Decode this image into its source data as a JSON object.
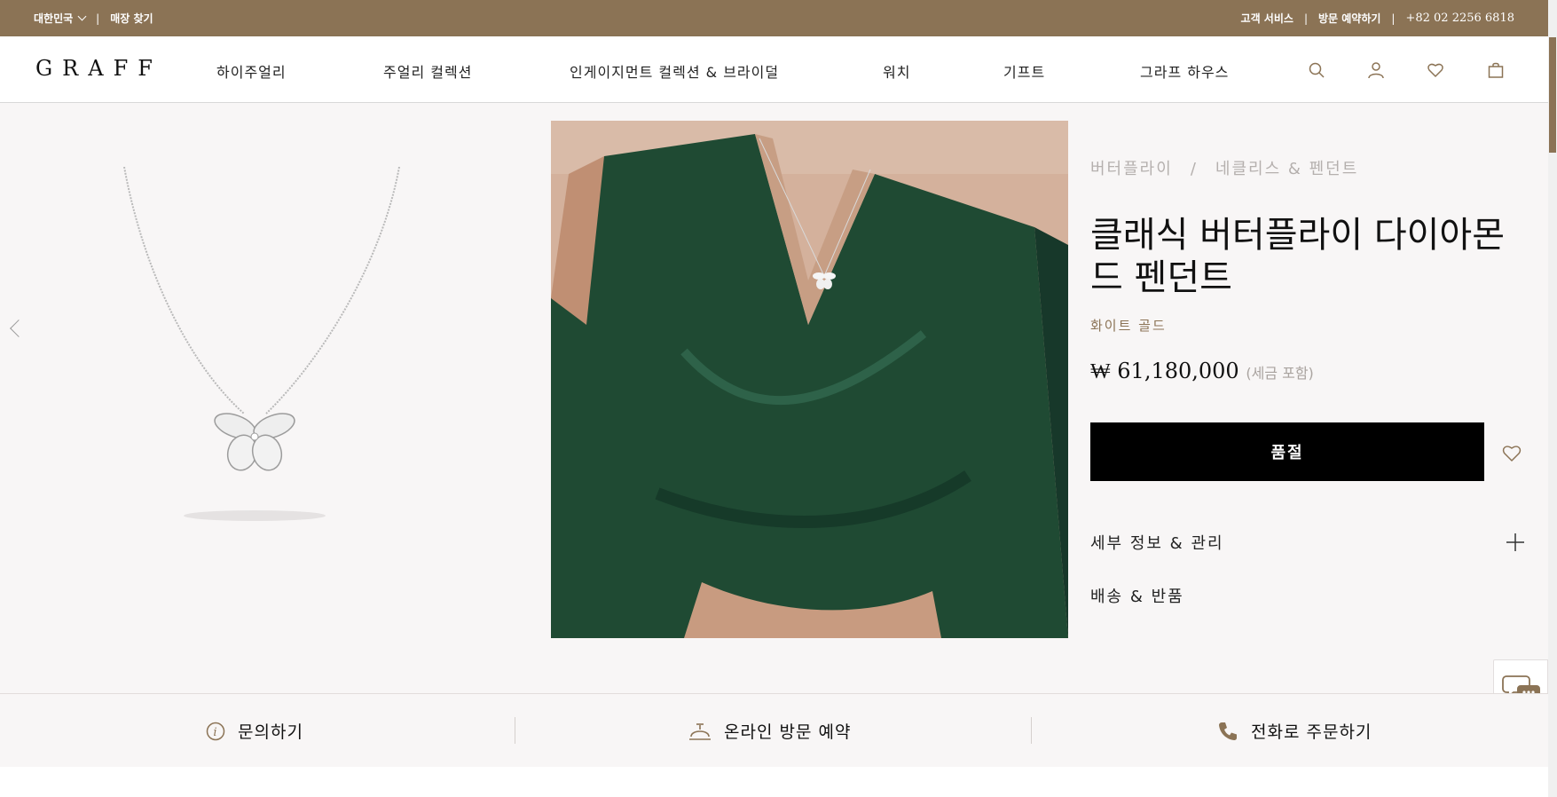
{
  "topbar": {
    "region": "대한민국",
    "store_finder": "매장 찾기",
    "customer_service": "고객 서비스",
    "book_visit": "방문 예약하기",
    "phone": "+82 02 2256 6818"
  },
  "header": {
    "logo": "GRAFF",
    "nav": [
      "하이주얼리",
      "주얼리 컬렉션",
      "인게이지먼트 컬렉션 & 브라이덜",
      "워치",
      "기프트",
      "그라프 하우스"
    ]
  },
  "product": {
    "breadcrumb": [
      "버터플라이",
      "네클리스 & 펜던트"
    ],
    "title": "클래식 버터플라이 다이아몬드 펜던트",
    "material": "화이트 골드",
    "price": "₩ 61,180,000",
    "tax_note": "(세금 포함)",
    "sold_out_label": "품절",
    "accordions": [
      "세부 정보 & 관리",
      "배송 & 반품"
    ]
  },
  "bottombar": {
    "inquire": "문의하기",
    "book_online": "온라인 방문 예약",
    "order_by_phone": "전화로 주문하기"
  },
  "colors": {
    "brand": "#8b7355",
    "background": "#f8f6f6",
    "button": "#000000",
    "dress": "#1f4a33"
  },
  "icons": [
    "chevron-down-icon",
    "search-icon",
    "account-icon",
    "heart-icon",
    "bag-icon",
    "chevron-left-icon",
    "chevron-right-icon",
    "plus-icon",
    "chat-icon",
    "info-icon",
    "concierge-bell-icon",
    "phone-icon"
  ]
}
